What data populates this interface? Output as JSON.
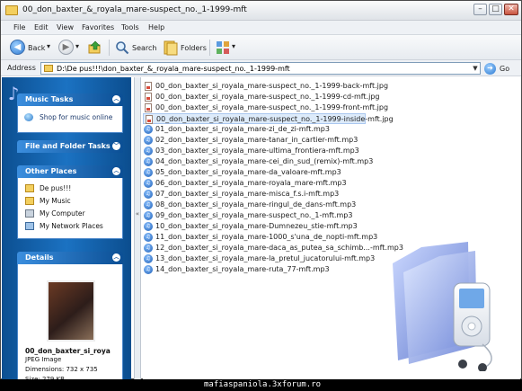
{
  "window": {
    "title": "00_don_baxter_&_royala_mare-suspect_no._1-1999-mft",
    "minimize": "–",
    "maximize": "□",
    "close": "✕"
  },
  "menu": [
    "File",
    "Edit",
    "View",
    "Favorites",
    "Tools",
    "Help"
  ],
  "toolbar": {
    "back_label": "Back",
    "search_label": "Search",
    "folders_label": "Folders",
    "dropdown_glyph": "▾"
  },
  "address": {
    "label": "Address",
    "path": "D:\\De pus!!!\\don_baxter_&_royala_mare-suspect_no._1-1999-mft",
    "go_label": "Go"
  },
  "left_pane": {
    "music_tasks": {
      "title": "Music Tasks",
      "items": [
        "Shop for music online"
      ]
    },
    "file_folder_tasks": {
      "title": "File and Folder Tasks"
    },
    "other_places": {
      "title": "Other Places",
      "items": [
        "De pus!!!",
        "My Music",
        "My Computer",
        "My Network Places"
      ]
    },
    "details": {
      "title": "Details",
      "name": "00_don_baxter_si_roya",
      "type": "JPEG Image",
      "dimensions": "Dimensions: 732 x 735",
      "size": "Size: 279 KB"
    }
  },
  "files": [
    {
      "name": "00_don_baxter_si_royala_mare-suspect_no._1-1999-back-mft.jpg",
      "kind": "jpg"
    },
    {
      "name": "00_don_baxter_si_royala_mare-suspect_no._1-1999-cd-mft.jpg",
      "kind": "jpg"
    },
    {
      "name": "00_don_baxter_si_royala_mare-suspect_no._1-1999-front-mft.jpg",
      "kind": "jpg"
    },
    {
      "name": "00_don_baxter_si_royala_mare-suspect_no._1-1999-inside-mft.jpg",
      "kind": "jpg"
    },
    {
      "name": "01_don_baxter_si_royala_mare-zi_de_zi-mft.mp3",
      "kind": "mp3"
    },
    {
      "name": "02_don_baxter_si_royala_mare-tanar_in_cartier-mft.mp3",
      "kind": "mp3"
    },
    {
      "name": "03_don_baxter_si_royala_mare-ultima_frontiera-mft.mp3",
      "kind": "mp3"
    },
    {
      "name": "04_don_baxter_si_royala_mare-cei_din_sud_(remix)-mft.mp3",
      "kind": "mp3"
    },
    {
      "name": "05_don_baxter_si_royala_mare-da_valoare-mft.mp3",
      "kind": "mp3"
    },
    {
      "name": "06_don_baxter_si_royala_mare-royala_mare-mft.mp3",
      "kind": "mp3"
    },
    {
      "name": "07_don_baxter_si_royala_mare-misca_f.s.i-mft.mp3",
      "kind": "mp3"
    },
    {
      "name": "08_don_baxter_si_royala_mare-ringul_de_dans-mft.mp3",
      "kind": "mp3"
    },
    {
      "name": "09_don_baxter_si_royala_mare-suspect_no._1-mft.mp3",
      "kind": "mp3"
    },
    {
      "name": "10_don_baxter_si_royala_mare-Dumnezeu_stie-mft.mp3",
      "kind": "mp3"
    },
    {
      "name": "11_don_baxter_si_royala_mare-1000_s'una_de_nopti-mft.mp3",
      "kind": "mp3"
    },
    {
      "name": "12_don_baxter_si_royala_mare-daca_as_putea_sa_schimb...-mft.mp3",
      "kind": "mp3"
    },
    {
      "name": "13_don_baxter_si_royala_mare-la_pretul_jucatorului-mft.mp3",
      "kind": "mp3"
    },
    {
      "name": "14_don_baxter_si_royala_mare-ruta_77-mft.mp3",
      "kind": "mp3"
    }
  ],
  "selected_file_index": 3,
  "watermark": "mafiaspaniola.3xforum.ro",
  "colors": {
    "left_pane": "#1b72c2",
    "panel_header": "#0b4f95",
    "selection": "#ddebfa"
  }
}
